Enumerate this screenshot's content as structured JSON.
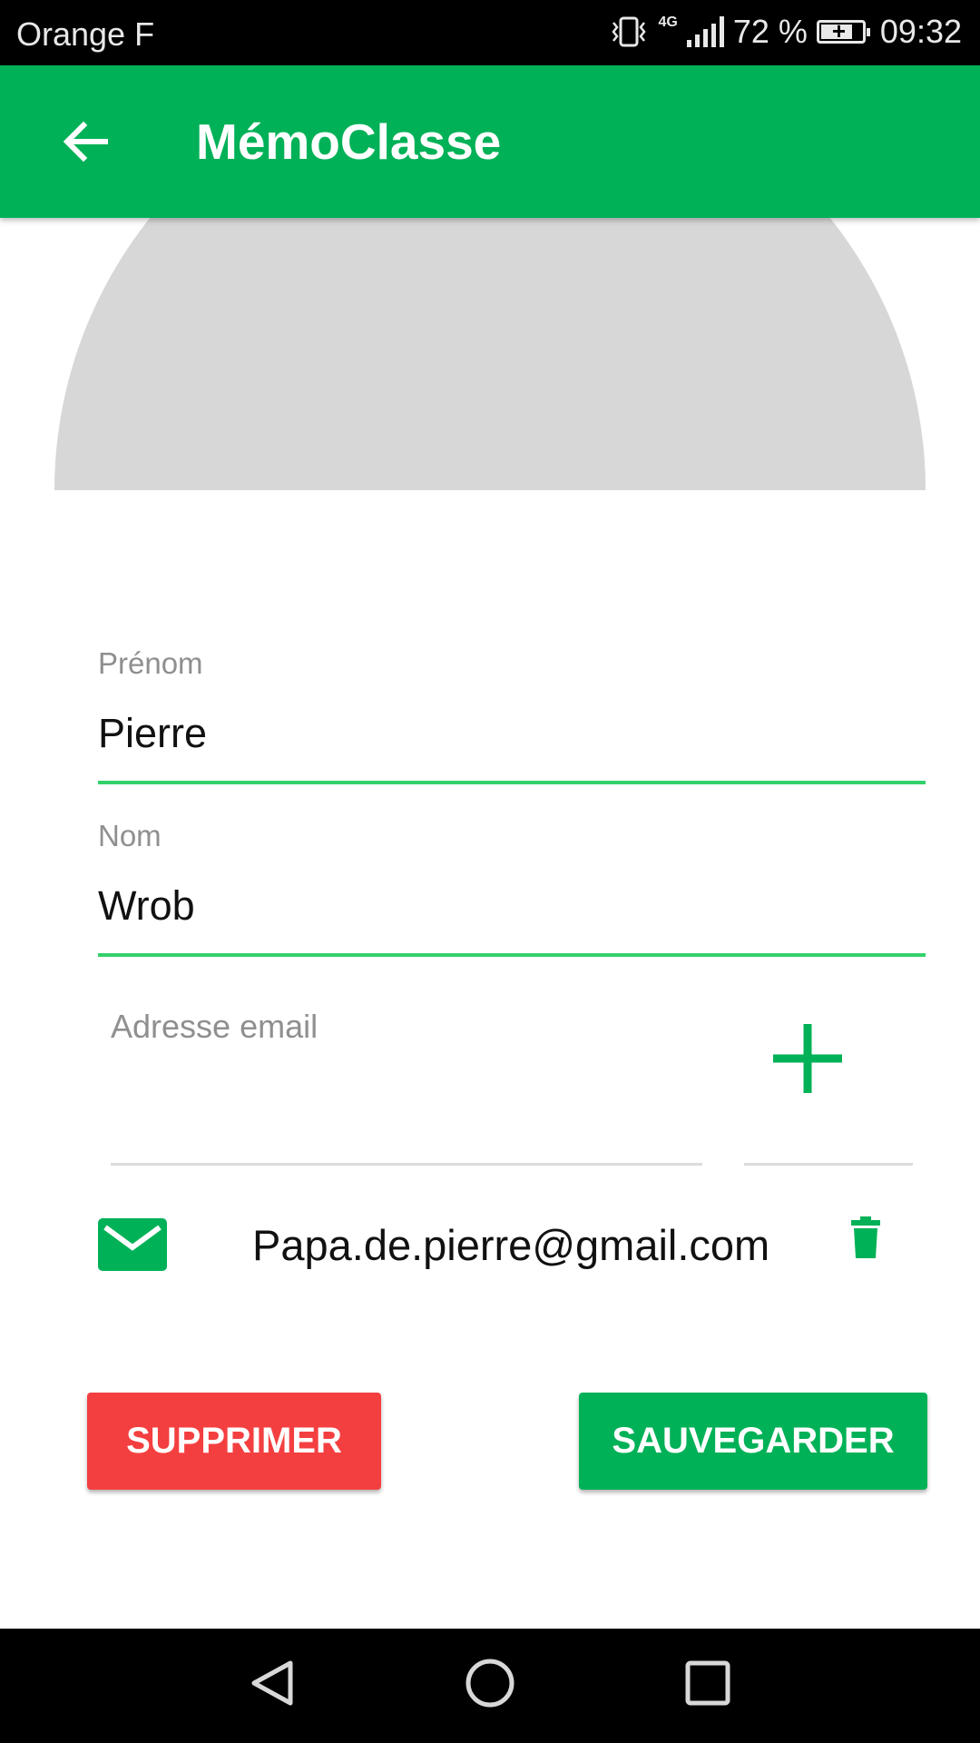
{
  "status_bar": {
    "carrier": "Orange F",
    "network": "4G",
    "battery": "72 %",
    "time": "09:32",
    "icons": [
      "vibrate-icon",
      "signal-icon",
      "battery-charging-icon"
    ]
  },
  "app_bar": {
    "title": "MémoClasse",
    "back_icon": "arrow-back-icon"
  },
  "form": {
    "first_name": {
      "label": "Prénom",
      "value": "Pierre"
    },
    "last_name": {
      "label": "Nom",
      "value": "Wrob"
    },
    "email": {
      "placeholder": "Adresse email",
      "value": ""
    },
    "add_icon": "plus-icon"
  },
  "emails": [
    {
      "address": "Papa.de.pierre@gmail.com",
      "icon": "mail-icon",
      "action_icon": "trash-icon"
    }
  ],
  "buttons": {
    "delete_label": "SUPPRIMER",
    "save_label": "SAUVEGARDER"
  },
  "colors": {
    "primary": "#00B157",
    "accent_line": "#33D16A",
    "danger": "#F43F40",
    "avatar_placeholder": "#D7D7D7"
  },
  "nav_bar": {
    "icons": [
      "back-triangle-icon",
      "home-circle-icon",
      "recents-square-icon"
    ]
  }
}
